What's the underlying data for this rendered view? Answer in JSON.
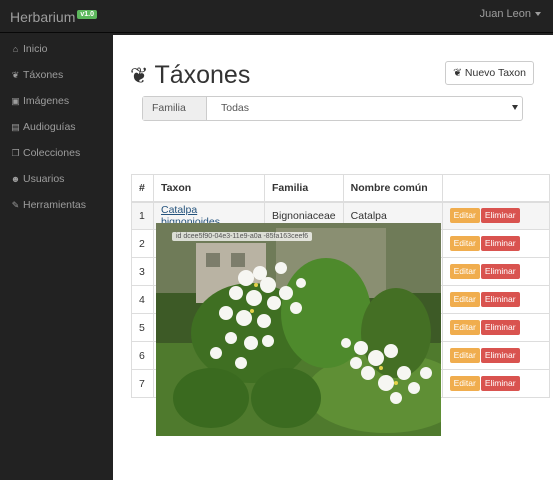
{
  "navbar": {
    "brand": "Herbarium",
    "version": "v1.0",
    "user": "Juan Leon"
  },
  "sidebar": {
    "items": [
      {
        "label": "Inicio",
        "icon": "home-icon"
      },
      {
        "label": "Táxones",
        "icon": "leaf-icon"
      },
      {
        "label": "Imágenes",
        "icon": "image-icon"
      },
      {
        "label": "Audioguías",
        "icon": "book-icon"
      },
      {
        "label": "Colecciones",
        "icon": "copy-icon"
      },
      {
        "label": "Usuarios",
        "icon": "users-icon"
      },
      {
        "label": "Herramientas",
        "icon": "wrench-icon"
      }
    ]
  },
  "main": {
    "title": "Táxones",
    "new_button": "Nuevo Taxon",
    "filter": {
      "label": "Familia",
      "selected": "Todas"
    },
    "table": {
      "headers": [
        "#",
        "Taxon",
        "Familia",
        "Nombre común",
        ""
      ],
      "rows": [
        {
          "num": "1",
          "taxon": "Catalpa bignonioides",
          "familia": "Bignoniaceae",
          "nombre": "Catalpa"
        },
        {
          "num": "2",
          "taxon": "",
          "familia": "",
          "nombre": ""
        },
        {
          "num": "3",
          "taxon": "",
          "familia": "",
          "nombre": ""
        },
        {
          "num": "4",
          "taxon": "",
          "familia": "",
          "nombre": ""
        },
        {
          "num": "5",
          "taxon": "",
          "familia": "",
          "nombre": ""
        },
        {
          "num": "6",
          "taxon": "",
          "familia": "",
          "nombre": ""
        },
        {
          "num": "7",
          "taxon": "",
          "familia": "",
          "nombre": ""
        }
      ],
      "edit_label": "Editar",
      "delete_label": "Eliminar"
    },
    "popup": {
      "image_id": "id dcee5f90-04e3-11e9-a0a -85fa163ceef6"
    }
  }
}
